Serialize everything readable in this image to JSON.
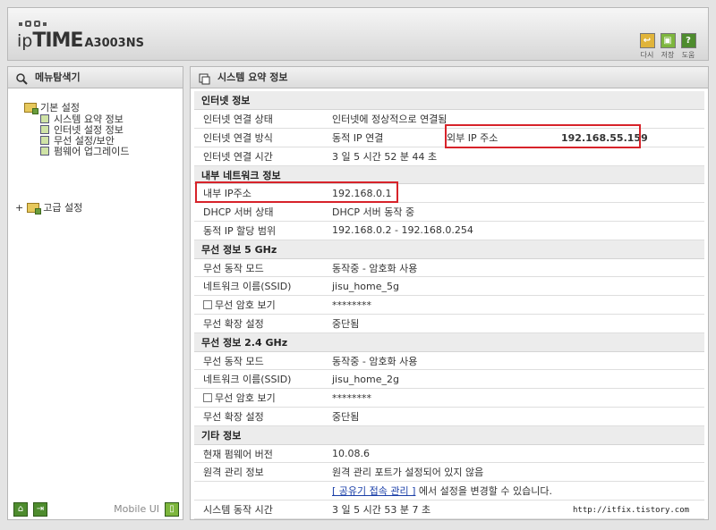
{
  "header": {
    "brand_ip": "ip",
    "brand_time": "TIME",
    "model": "A3003NS",
    "buttons": [
      {
        "label": "다시",
        "icon": "reload-icon",
        "color": "#e0b43a"
      },
      {
        "label": "저장",
        "icon": "save-icon",
        "color": "#7db63d"
      },
      {
        "label": "도움",
        "icon": "help-icon",
        "color": "#4e8c2e",
        "glyph": "?"
      }
    ]
  },
  "sidebar": {
    "title": "메뉴탐색기",
    "basic": {
      "label": "기본 설정",
      "items": [
        "시스템 요약 정보",
        "인터넷 설정 정보",
        "무선 설정/보안",
        "펌웨어 업그레이드"
      ]
    },
    "advanced": {
      "expander": "+",
      "label": "고급 설정"
    },
    "footer": {
      "mobile_label": "Mobile UI"
    }
  },
  "main": {
    "title": "시스템 요약 정보",
    "sections": {
      "internet": {
        "title": "인터넷 정보",
        "rows": [
          {
            "key": "인터넷 연결 상태",
            "value": "인터넷에 정상적으로 연결됨"
          },
          {
            "key": "인터넷 연결 방식",
            "value": "동적 IP 연결",
            "extra_key": "외부 IP 주소",
            "extra_value": "192.168.55.159"
          },
          {
            "key": "인터넷 연결 시간",
            "value": "3 일 5 시간 52 분 44 초"
          }
        ]
      },
      "lan": {
        "title": "내부 네트워크 정보",
        "rows": [
          {
            "key": "내부 IP주소",
            "value": "192.168.0.1"
          },
          {
            "key": "DHCP 서버 상태",
            "value": "DHCP 서버 동작 중"
          },
          {
            "key": "동적 IP 할당 범위",
            "value": "192.168.0.2 -  192.168.0.254"
          }
        ]
      },
      "wireless5": {
        "title": "무선 정보 5 GHz",
        "rows": [
          {
            "key": "무선 동작 모드",
            "value": "동작중 - 암호화 사용"
          },
          {
            "key": "네트워크 이름(SSID)",
            "value": "jisu_home_5g"
          },
          {
            "key": "무선 암호 보기",
            "value": "********"
          },
          {
            "key": "무선 확장 설정",
            "value": "중단됨"
          }
        ]
      },
      "wireless24": {
        "title": "무선 정보 2.4 GHz",
        "rows": [
          {
            "key": "무선 동작 모드",
            "value": "동작중 - 암호화 사용"
          },
          {
            "key": "네트워크 이름(SSID)",
            "value": "jisu_home_2g"
          },
          {
            "key": "무선 암호 보기",
            "value": "********"
          },
          {
            "key": "무선 확장 설정",
            "value": "중단됨"
          }
        ]
      },
      "etc": {
        "title": "기타 정보",
        "rows": [
          {
            "key": "현재 펌웨어 버전",
            "value": "10.08.6"
          },
          {
            "key": "원격 관리 정보",
            "value": "원격 관리 포트가 설정되어 있지 않음"
          },
          {
            "link": "[ 공유기 접속 관리 ]",
            "link_suffix": "에서 설정을 변경할 수 있습니다."
          },
          {
            "key": "시스템 동작 시간",
            "value": "3 일 5 시간 53 분 7 초"
          }
        ]
      }
    }
  },
  "watermark": "http://itfix.tistory.com",
  "colors": {
    "highlight_box": "#d7232a",
    "accent_green": "#4e8c2e",
    "link": "#1a3fa8"
  }
}
